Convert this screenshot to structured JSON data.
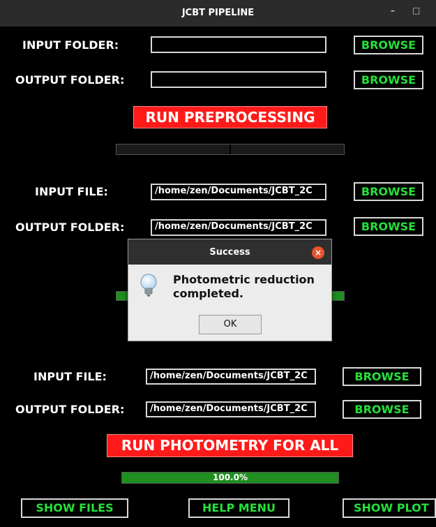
{
  "window": {
    "title": "JCBT PIPELINE",
    "minimize": "–",
    "maximize": "□"
  },
  "section1": {
    "input_folder_label": "INPUT FOLDER:",
    "input_folder_value": "",
    "output_folder_label": "OUTPUT FOLDER:",
    "output_folder_value": "",
    "browse_label": "BROWSE",
    "run_label": "RUN PREPROCESSING",
    "progress": 0
  },
  "section2": {
    "input_file_label": "INPUT FILE:",
    "input_file_value": "/home/zen/Documents/JCBT_2C",
    "output_folder_label": "OUTPUT FOLDER:",
    "output_folder_value": "/home/zen/Documents/JCBT_2C",
    "browse_label": "BROWSE"
  },
  "dialog": {
    "title": "Success",
    "message": "Photometric reduction completed.",
    "ok_label": "OK",
    "close_glyph": "×"
  },
  "section3": {
    "input_file_label": "INPUT FILE:",
    "input_file_value": "/home/zen/Documents/JCBT_2C",
    "output_folder_label": "OUTPUT FOLDER:",
    "output_folder_value": "/home/zen/Documents/JCBT_2C",
    "browse_label": "BROWSE",
    "run_label": "RUN PHOTOMETRY FOR ALL",
    "progress_text": "100.0%",
    "progress": 1.0
  },
  "bottom": {
    "show_files": "SHOW FILES",
    "help_menu": "HELP MENU",
    "show_plot": "SHOW PLOT"
  },
  "colors": {
    "accent_green": "#25e03a",
    "run_red": "#ff1a1a",
    "progress_green": "#1f8f1f"
  }
}
